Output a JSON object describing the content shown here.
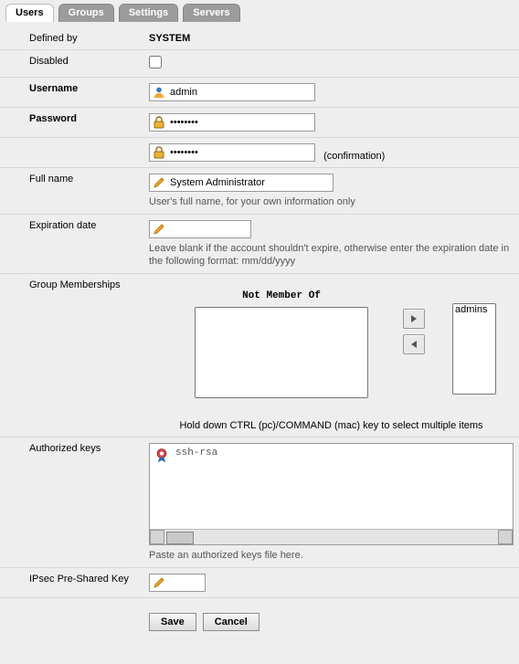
{
  "tabs": [
    {
      "id": "users",
      "label": "Users",
      "active": true
    },
    {
      "id": "groups",
      "label": "Groups",
      "active": false
    },
    {
      "id": "settings",
      "label": "Settings",
      "active": false
    },
    {
      "id": "servers",
      "label": "Servers",
      "active": false
    }
  ],
  "fields": {
    "defined_by": {
      "label": "Defined by",
      "value": "SYSTEM"
    },
    "disabled": {
      "label": "Disabled",
      "checked": false
    },
    "username": {
      "label": "Username",
      "value": "admin"
    },
    "password": {
      "label": "Password",
      "value": "••••••••"
    },
    "password_confirm": {
      "value": "••••••••",
      "hint": "(confirmation)"
    },
    "full_name": {
      "label": "Full name",
      "value": "System Administrator",
      "hint": "User's full name, for your own information only"
    },
    "expiration": {
      "label": "Expiration date",
      "value": "",
      "hint": "Leave blank if the account shouldn't expire, otherwise enter the expiration date in the following format: mm/dd/yyyy"
    },
    "group_memberships": {
      "label": "Group Memberships",
      "not_member_title": "Not Member Of",
      "not_member": [],
      "member": [
        "admins"
      ],
      "ctrl_hint": "Hold down CTRL (pc)/COMMAND (mac) key to select multiple items"
    },
    "authorized_keys": {
      "label": "Authorized keys",
      "value": "ssh-rsa",
      "hint": "Paste an authorized keys file here."
    },
    "ipsec_psk": {
      "label": "IPsec Pre-Shared Key",
      "value": ""
    }
  },
  "buttons": {
    "save": "Save",
    "cancel": "Cancel"
  }
}
